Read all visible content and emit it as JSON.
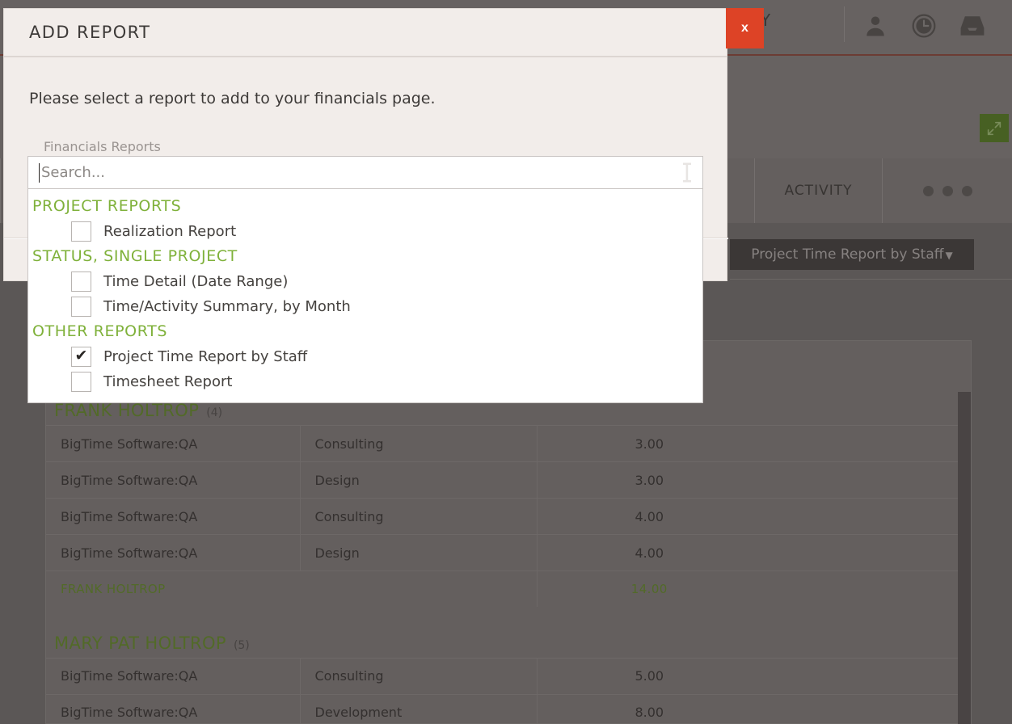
{
  "header": {
    "company_label": "PANY",
    "icons": [
      {
        "name": "user-icon",
        "label": "User"
      },
      {
        "name": "clock-icon",
        "label": "Time"
      },
      {
        "name": "inbox-icon",
        "label": "Inbox"
      }
    ],
    "expand_button_label": "Expand"
  },
  "tabs": [
    {
      "label": "ACTIVITY",
      "name": "tab-activity",
      "width": 158
    },
    {
      "label": "",
      "name": "tab-more",
      "width": 160,
      "dots": 3
    }
  ],
  "report_selector": {
    "label": "Project Time Report by Staff",
    "caret": "▼"
  },
  "modal": {
    "title": "ADD REPORT",
    "close_label": "x",
    "instruction": "Please select a report to add to your financials page.",
    "field_label": "Financials Reports"
  },
  "search": {
    "placeholder": "Search...",
    "value": ""
  },
  "dropdown": {
    "groups": [
      {
        "label": "PROJECT REPORTS",
        "items": [
          {
            "label": "Realization Report",
            "checked": false
          }
        ]
      },
      {
        "label": "STATUS, SINGLE PROJECT",
        "items": [
          {
            "label": "Time Detail (Date Range)",
            "checked": false
          },
          {
            "label": "Time/Activity Summary, by Month",
            "checked": false
          }
        ]
      },
      {
        "label": "OTHER REPORTS",
        "items": [
          {
            "label": "Project Time Report by Staff",
            "checked": true
          },
          {
            "label": "Timesheet Report",
            "checked": false
          }
        ]
      }
    ],
    "check_glyph": "✔"
  },
  "report": {
    "groups": [
      {
        "name": "FRANK HOLTROP",
        "count": "(4)",
        "rows": [
          {
            "project": "BigTime Software:QA",
            "activity": "Consulting",
            "hours": "3.00"
          },
          {
            "project": "BigTime Software:QA",
            "activity": "Design",
            "hours": "3.00"
          },
          {
            "project": "BigTime Software:QA",
            "activity": "Consulting",
            "hours": "4.00"
          },
          {
            "project": "BigTime Software:QA",
            "activity": "Design",
            "hours": "4.00"
          }
        ],
        "total_label": "FRANK HOLTROP",
        "total_value": "14.00"
      },
      {
        "name": "MARY PAT HOLTROP",
        "count": "(5)",
        "rows": [
          {
            "project": "BigTime Software:QA",
            "activity": "Consulting",
            "hours": "5.00"
          },
          {
            "project": "BigTime Software:QA",
            "activity": "Development",
            "hours": "8.00"
          }
        ],
        "total_label": "",
        "total_value": ""
      }
    ]
  },
  "colors": {
    "accent_green": "#5f8a20",
    "dropdown_green": "#7fb13a",
    "close_red": "#dd4326",
    "expand_green": "#4e7a17",
    "modal_bg": "#f2edea",
    "app_grey": "#7c7876"
  }
}
